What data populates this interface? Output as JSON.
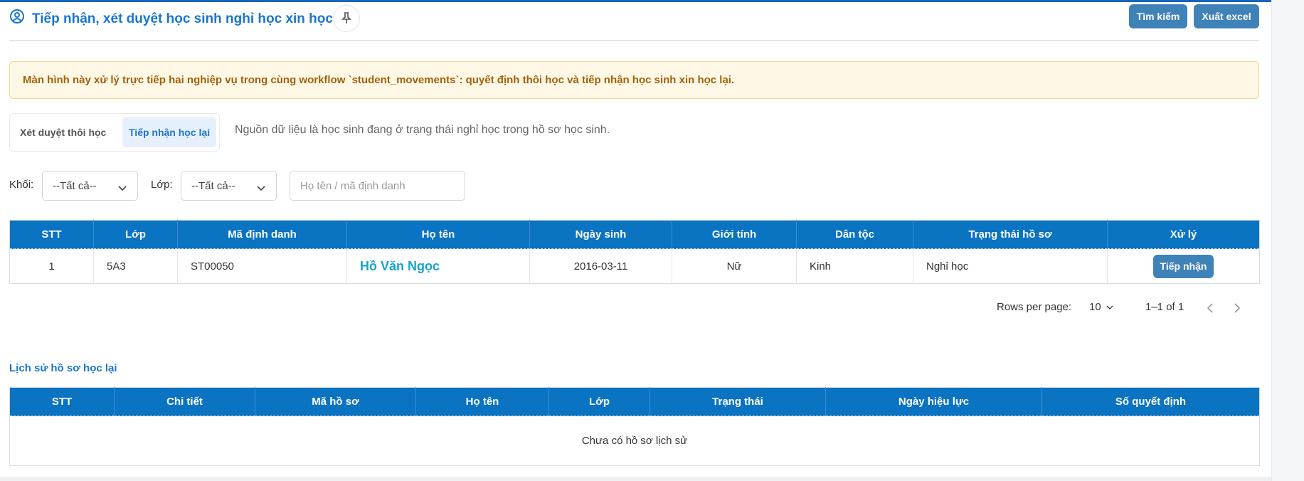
{
  "header": {
    "title": "Tiếp nhận, xét duyệt học sinh nghỉ học xin học lại",
    "search_label": "Tìm kiếm",
    "export_label": "Xuất excel"
  },
  "alert": {
    "text": "Màn hình này xử lý trực tiếp hai nghiệp vụ trong cùng workflow `student_movements`: quyết định thôi học và tiếp nhận học sinh xin học lại."
  },
  "tabs": [
    {
      "label": "Xét duyệt thôi học",
      "active": false
    },
    {
      "label": "Tiếp nhận học lại",
      "active": true
    }
  ],
  "note": "Nguồn dữ liệu là học sinh đang ở trạng thái nghỉ học trong hồ sơ học sinh.",
  "filters": {
    "grade_label": "Khối:",
    "grade_value": "--Tất cả--",
    "class_label": "Lớp:",
    "class_value": "--Tất cả--",
    "search_placeholder": "Họ tên / mã định danh"
  },
  "main_table": {
    "headers": [
      "STT",
      "Lớp",
      "Mã định danh",
      "Họ tên",
      "Ngày sinh",
      "Giới tính",
      "Dân tộc",
      "Trạng thái hồ sơ",
      "Xử lý"
    ],
    "rows": [
      {
        "stt": "1",
        "class": "5A3",
        "id": "ST00050",
        "name": "Hồ Văn Ngọc",
        "dob": "2016-03-11",
        "gender": "Nữ",
        "ethnicity": "Kinh",
        "status": "Nghỉ học",
        "action": "Tiếp nhận"
      }
    ]
  },
  "pagination": {
    "rows_per_page_label": "Rows per page:",
    "rows_per_page_value": "10",
    "range": "1–1 of 1"
  },
  "history": {
    "title": "Lịch sử hồ sơ học lại",
    "headers": [
      "STT",
      "Chi tiết",
      "Mã hồ sơ",
      "Họ tên",
      "Lớp",
      "Trạng thái",
      "Ngày hiệu lực",
      "Số quyết định"
    ],
    "empty_text": "Chưa có hồ sơ lịch sử"
  },
  "colors": {
    "primary": "#1976d2",
    "table_header": "#0a73c2",
    "button": "#3f82b8",
    "alert_bg": "#fff8e6",
    "alert_text": "#a0620a",
    "link": "#14a4d0"
  },
  "icons": {
    "title": "user-circle-icon",
    "pin": "pin-icon",
    "dropdown": "chevron-down-icon",
    "prev": "chevron-left-icon",
    "next": "chevron-right-icon"
  }
}
